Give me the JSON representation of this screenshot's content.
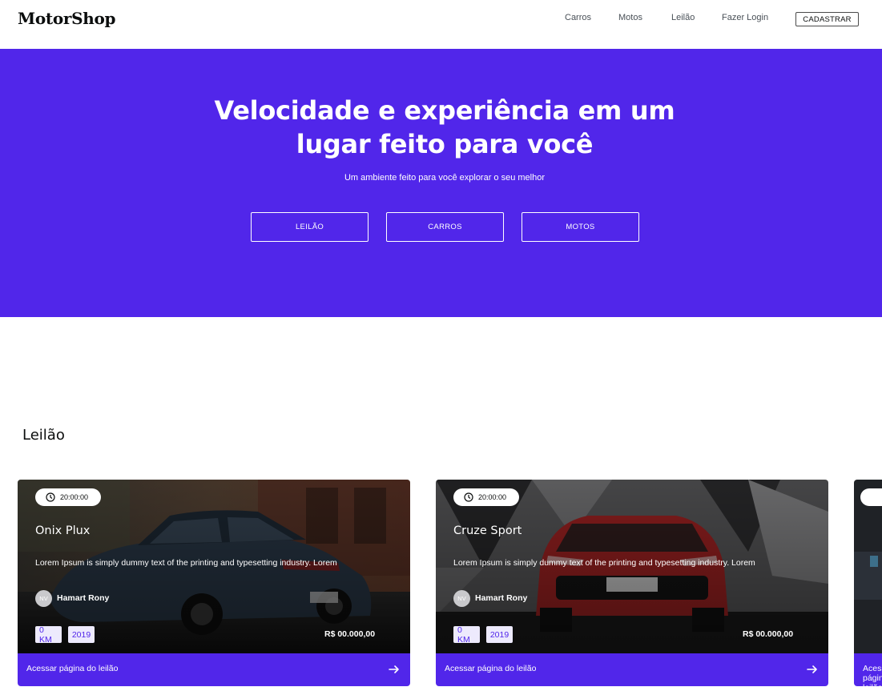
{
  "header": {
    "logo": "MotorShop",
    "nav": {
      "carros": "Carros",
      "motos": "Motos",
      "leilao": "Leilão",
      "login": "Fazer Login"
    },
    "signup_label": "CADASTRAR"
  },
  "hero": {
    "title_line1": "Velocidade e experiência em um",
    "title_line2": "lugar feito para você",
    "subtitle": "Um ambiente feito para você explorar o seu melhor",
    "buttons": {
      "leilao": "LEILÃO",
      "carros": "CARROS",
      "motos": "MOTOS"
    }
  },
  "auction": {
    "section_title": "Leilão",
    "cards": [
      {
        "time": "20:00:00",
        "title": "Onix Plux",
        "description": "Lorem Ipsum is simply dummy text of the printing and typesetting industry. Lorem",
        "owner_initials": "NV",
        "owner_name": "Hamart Rony",
        "km": "0 KM",
        "year": "2019",
        "price": "R$ 00.000,00",
        "cta": "Acessar página do leilão"
      },
      {
        "time": "20:00:00",
        "title": "Cruze Sport",
        "description": "Lorem Ipsum is simply dummy text of the printing and typesetting industry. Lorem",
        "owner_initials": "NV",
        "owner_name": "Hamart Rony",
        "km": "0 KM",
        "year": "2019",
        "price": "R$ 00.000,00",
        "cta": "Acessar página do leilão"
      },
      {
        "cta": "Acessar página do leilão"
      }
    ]
  },
  "colors": {
    "brand": "#5126ea",
    "tag_bg": "#edeafd",
    "text_dark": "#0b0d0d"
  }
}
